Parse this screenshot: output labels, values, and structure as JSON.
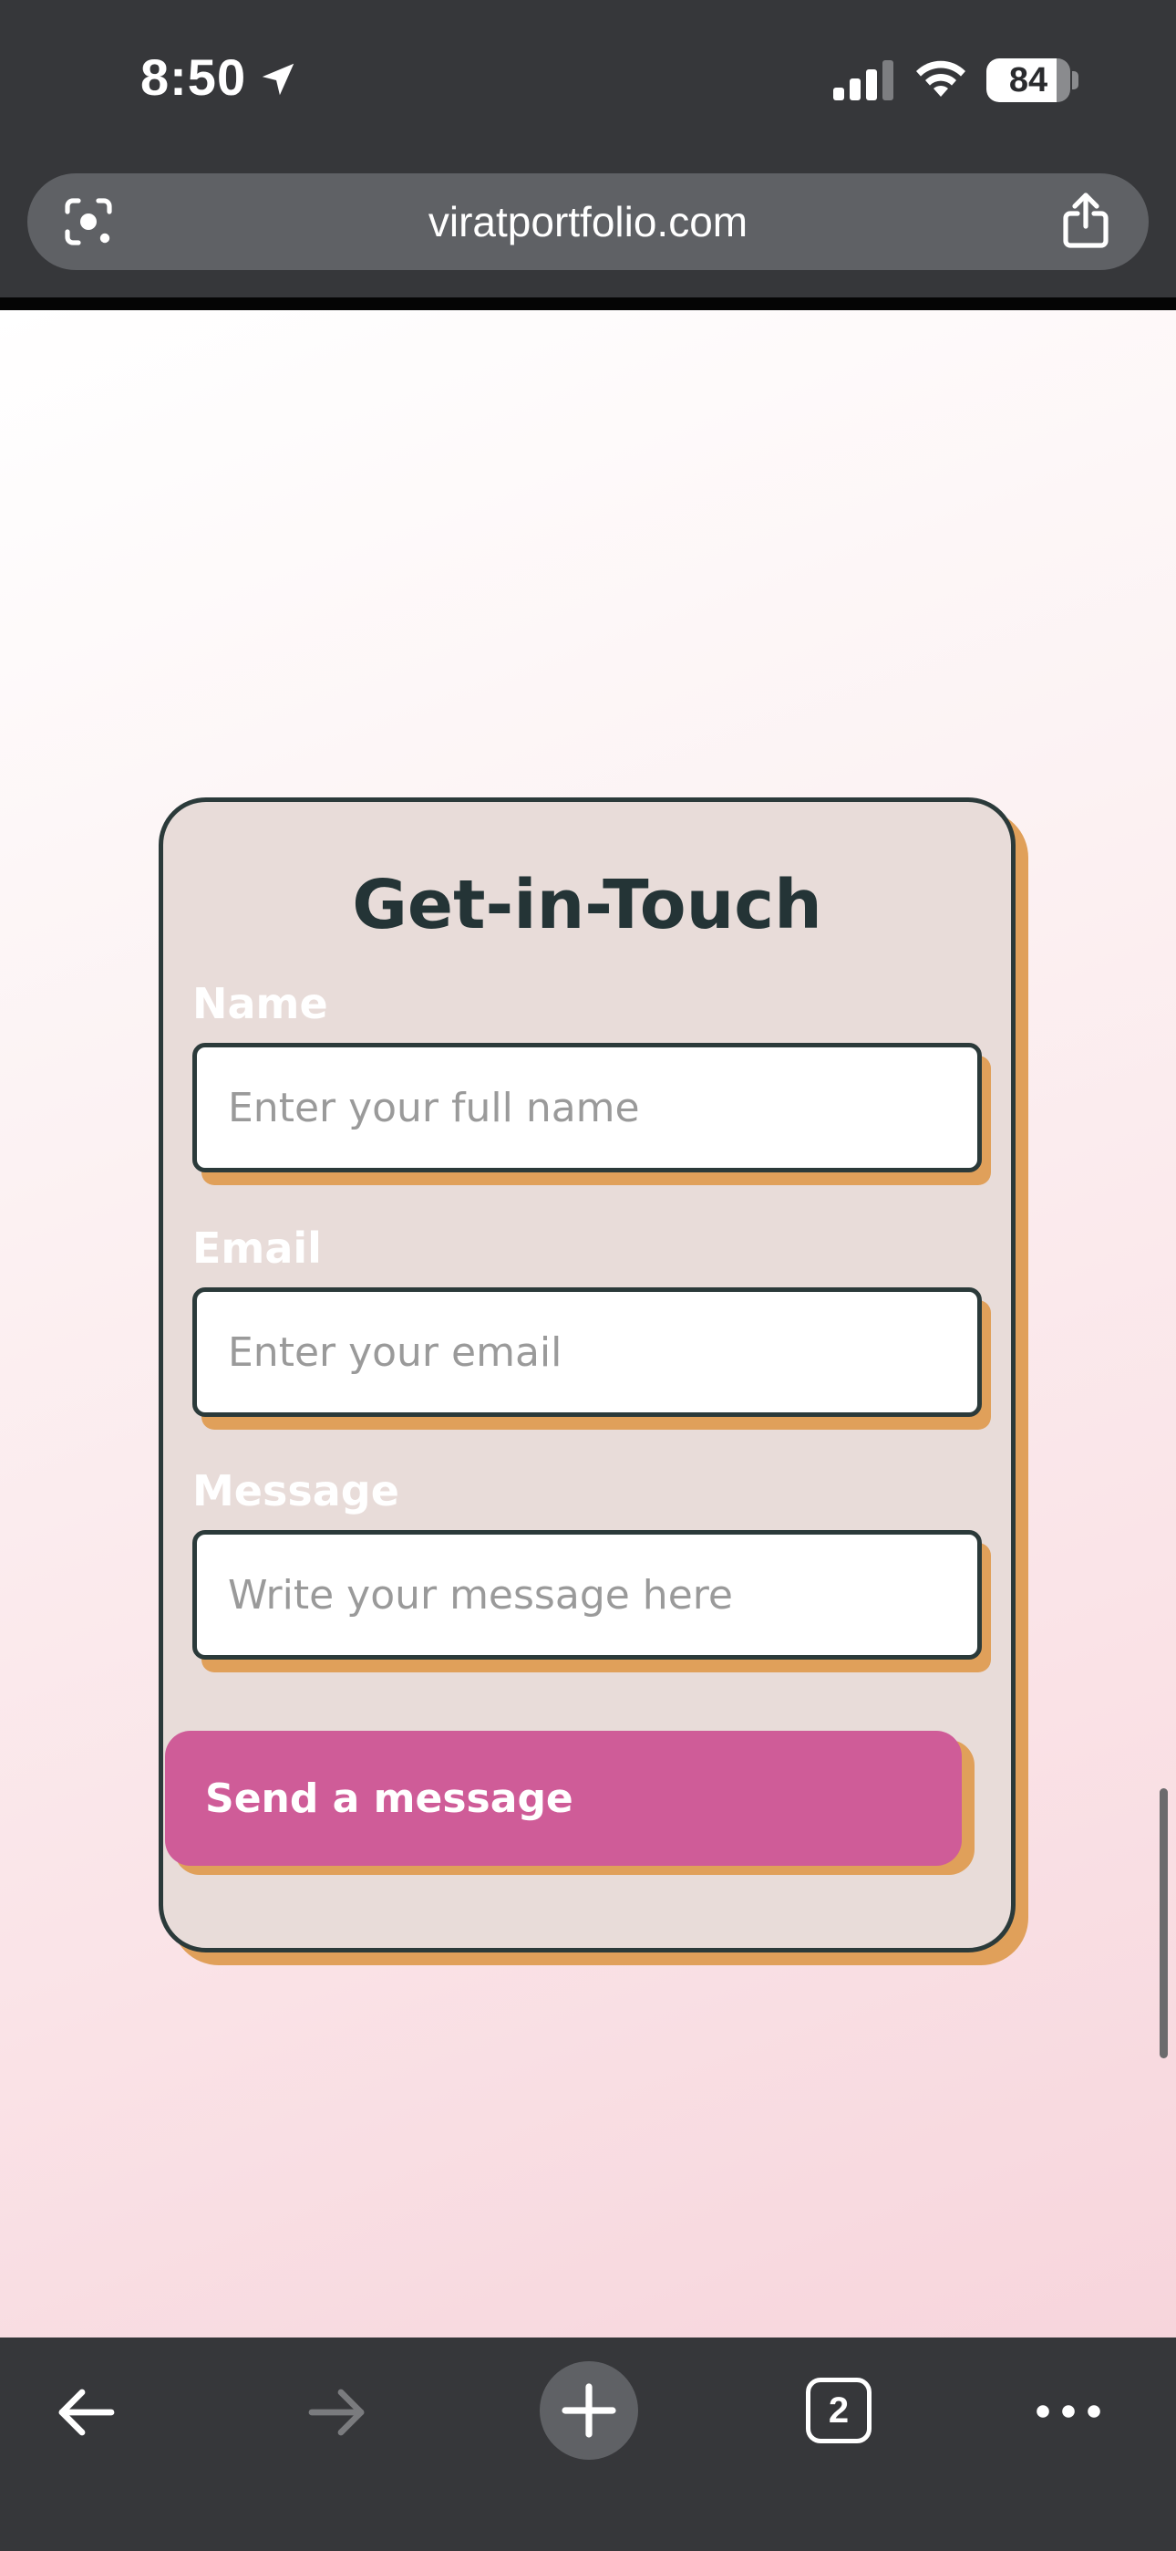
{
  "status_bar": {
    "time": "8:50",
    "battery_level": "84",
    "battery_fraction": 0.84
  },
  "browser": {
    "url": "viratportfolio.com",
    "tab_count": "2"
  },
  "form": {
    "title": "Get-in-Touch",
    "name_label": "Name",
    "name_placeholder": "Enter your full name",
    "email_label": "Email",
    "email_placeholder": "Enter your email",
    "message_label": "Message",
    "message_placeholder": "Write your message here",
    "submit_label": "Send a message"
  },
  "colors": {
    "card_background": "#e8dcd9",
    "card_border": "#2b3a3a",
    "accent_shadow": "#e0a05a",
    "button": "#cf5c98",
    "title_text": "#243436"
  },
  "icons": {
    "status": [
      "location-arrow-icon",
      "cellular-signal-icon",
      "wifi-icon",
      "battery-icon"
    ],
    "url_bar": [
      "google-lens-icon",
      "share-icon"
    ],
    "toolbar": [
      "back-arrow-icon",
      "forward-arrow-icon",
      "plus-icon",
      "tabs-icon",
      "more-icon"
    ]
  }
}
